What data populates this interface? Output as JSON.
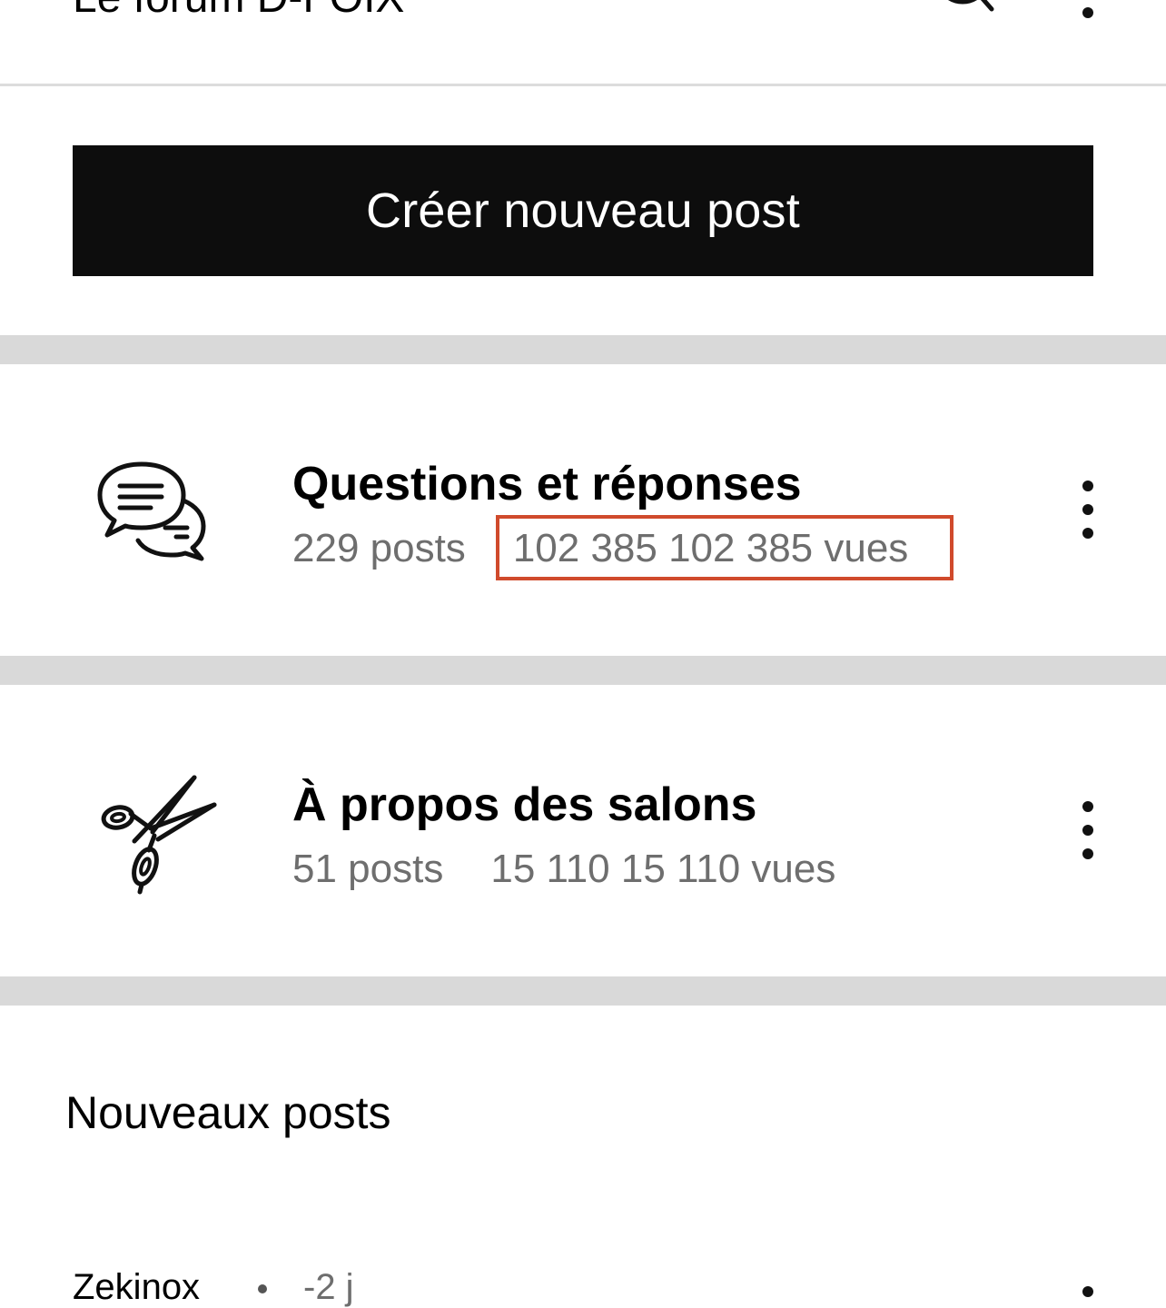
{
  "header": {
    "title": "Le forum D-FOIX"
  },
  "actions": {
    "create_post_label": "Créer nouveau post"
  },
  "categories": [
    {
      "title": "Questions et réponses",
      "posts": "229 posts",
      "views": "102 385 102 385 vues",
      "icon": "chat-bubbles-icon"
    },
    {
      "title": "À propos des salons",
      "posts": "51 posts",
      "views": "15 110 15 110 vues",
      "icon": "scissors-icon"
    }
  ],
  "new_posts": {
    "title": "Nouveaux posts",
    "items": [
      {
        "author": "Zekinox",
        "time": "-2 j"
      }
    ]
  },
  "colors": {
    "button_bg": "#0d0d0d",
    "band": "#d9d9d9",
    "muted_text": "#6e6e6e",
    "highlight": "#d04a2c"
  }
}
